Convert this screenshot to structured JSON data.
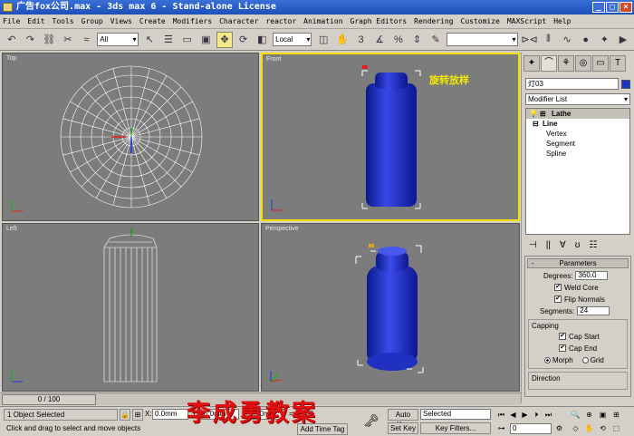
{
  "window": {
    "title": "广告fox公司.max - 3ds max 6 - Stand-alone License",
    "controls": {
      "minimize": "_",
      "maximize": "□",
      "close": "×"
    }
  },
  "menu": [
    "File",
    "Edit",
    "Tools",
    "Group",
    "Views",
    "Create",
    "Modifiers",
    "Character",
    "reactor",
    "Animation",
    "Graph Editors",
    "Rendering",
    "Customize",
    "MAXScript",
    "Help"
  ],
  "toolbar": {
    "selection_filter": "All",
    "reference_coord": "Local",
    "named_selection": ""
  },
  "viewports": {
    "top": {
      "label": "Top"
    },
    "front": {
      "label": "Front",
      "annotation": "旋转放样"
    },
    "left": {
      "label": "Left"
    },
    "perspective": {
      "label": "Perspective"
    }
  },
  "command_panel": {
    "object_name": "灯03",
    "object_color": "#1d33c8",
    "modifier_list": "Modifier List",
    "stack": {
      "lathe": "Lathe",
      "line": "Line",
      "vertex": "Vertex",
      "segment": "Segment",
      "spline": "Spline"
    },
    "parameters": {
      "title": "Parameters",
      "degrees_label": "Degrees:",
      "degrees": "360.0",
      "weld_core": "Weld Core",
      "flip_normals": "Flip Normals",
      "segments_label": "Segments:",
      "segments": "24",
      "capping_label": "Capping",
      "cap_start": "Cap Start",
      "cap_end": "Cap End",
      "morph": "Morph",
      "grid": "Grid",
      "direction_label": "Direction"
    }
  },
  "timeline": {
    "position": "0 / 100"
  },
  "status": {
    "selection": "1 Object Selected",
    "prompt": "Click and drag to select and move objects",
    "x": "0.0mm",
    "y": "0.0mm",
    "z": "0.0mm",
    "grid": "= 254.0",
    "add_time_tag": "Add Time Tag",
    "auto_key": "Auto Key",
    "set_key": "Set Key",
    "key_mode": "Selected",
    "key_filters": "Key Filters...",
    "frame": "0"
  },
  "watermark": "李成勇教案"
}
